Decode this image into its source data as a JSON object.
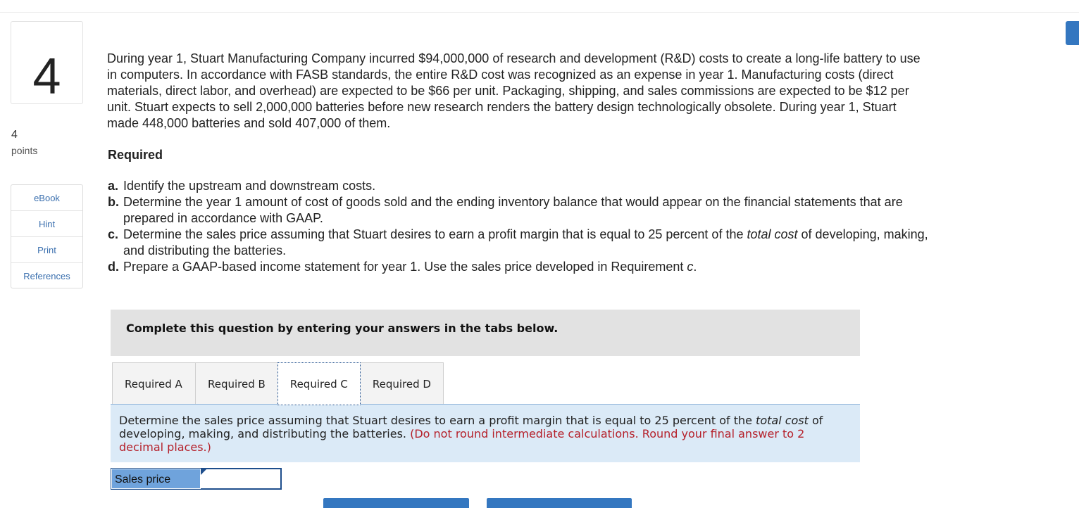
{
  "question": {
    "number": "4",
    "points_value": "4",
    "points_label": "points"
  },
  "side_menu": {
    "items": [
      "eBook",
      "Hint",
      "Print",
      "References"
    ]
  },
  "problem_text": "During year 1, Stuart Manufacturing Company incurred $94,000,000 of research and development (R&D) costs to create a long-life battery to use in computers. In accordance with FASB standards, the entire R&D cost was recognized as an expense in year 1. Manufacturing costs (direct materials, direct labor, and overhead) are expected to be $66 per unit. Packaging, shipping, and sales commissions are expected to be $12 per unit. Stuart expects to sell 2,000,000 batteries before new research renders the battery design technologically obsolete. During year 1, Stuart made 448,000 batteries and sold 407,000 of them.",
  "required_heading": "Required",
  "requirements": [
    {
      "letter": "a.",
      "text": "Identify the upstream and downstream costs."
    },
    {
      "letter": "b.",
      "text": "Determine the year 1 amount of cost of goods sold and the ending inventory balance that would appear on the financial statements that are prepared in accordance with GAAP."
    },
    {
      "letter": "c.",
      "text_before": "Determine the sales price assuming that Stuart desires to earn a profit margin that is equal to 25 percent of the ",
      "text_italic": "total cost",
      "text_after": " of developing, making, and distributing the batteries."
    },
    {
      "letter": "d.",
      "text_before": "Prepare a GAAP-based income statement for year 1. Use the sales price developed in Requirement ",
      "text_italic": "c",
      "text_after": "."
    }
  ],
  "instruction_bar": "Complete this question by entering your answers in the tabs below.",
  "tabs": [
    {
      "label": "Required A",
      "active": false
    },
    {
      "label": "Required B",
      "active": false
    },
    {
      "label": "Required C",
      "active": true
    },
    {
      "label": "Required D",
      "active": false
    }
  ],
  "tab_panel": {
    "text_before": "Determine the sales price assuming that Stuart desires to earn a profit margin that is equal to 25 percent of the ",
    "text_italic": "total cost",
    "text_after": " of developing, making, and distributing the batteries.",
    "note": "(Do not round intermediate calculations. Round your final answer to 2 decimal places.)"
  },
  "answer": {
    "label": "Sales price",
    "value": ""
  },
  "colors": {
    "accent_blue": "#3477c0",
    "label_blue": "#6fa3dc",
    "panel_bg": "#dbeaf7",
    "note_red": "#b5202a",
    "link_blue": "#3a6fae"
  }
}
